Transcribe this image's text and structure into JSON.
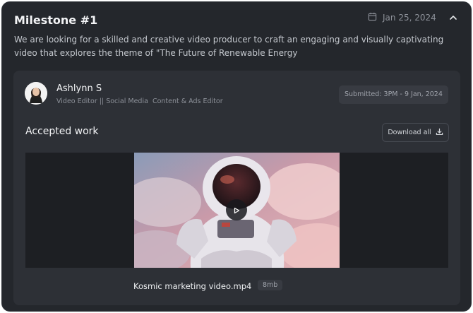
{
  "milestone": {
    "title": "Milestone #1",
    "date": "Jan 25, 2024",
    "description": "We are looking for a skilled and creative video producer to craft an engaging and visually captivating video that explores the theme of \"The Future of Renewable Energy"
  },
  "submission": {
    "name": "Ashlynn S",
    "role": "Video Editor || Social Media  Content & Ads Editor",
    "submitted": "Submitted: 3PM - 9 Jan, 2024",
    "accepted_heading": "Accepted work",
    "download_label": "Download all",
    "file_name": "Kosmic marketing video.mp4",
    "file_size": "8mb"
  },
  "icons": {
    "calendar": "calendar-icon",
    "collapse": "chevron-up-icon",
    "download": "download-icon",
    "play": "play-icon"
  },
  "colors": {
    "card_bg": "#24272c",
    "inner_bg": "#2d3036",
    "text_primary": "#f2f3f5",
    "text_muted": "#8d9199"
  }
}
